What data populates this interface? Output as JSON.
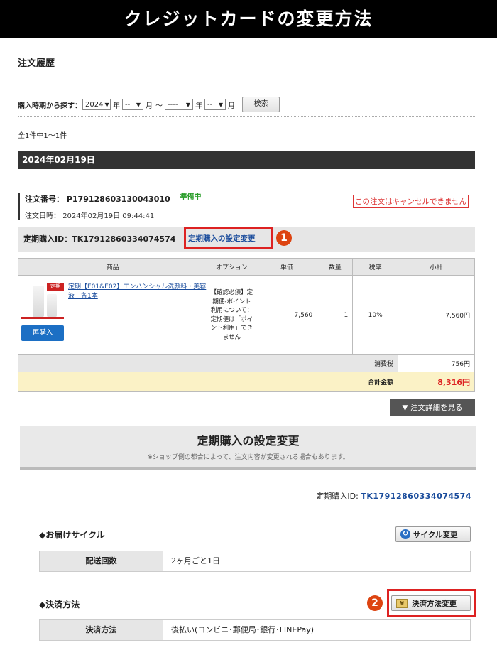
{
  "banner": "クレジットカードの変更方法",
  "section_title": "注文履歴",
  "search": {
    "label": "購入時期から探す：",
    "year_value": "2024",
    "year_unit": "年",
    "month_value": "--",
    "month_unit": "月",
    "tilde": "～",
    "year2_value": "----",
    "year2_unit": "年",
    "month2_value": "--",
    "month2_unit": "月",
    "button": "検索"
  },
  "result_count": "全1件中1～1件",
  "date_band": "2024年02月19日",
  "order": {
    "number_label": "注文番号：",
    "number": "P179128603130043010",
    "status": "準備中",
    "date_label": "注文日時：",
    "date": "2024年02月19日 09:44:41",
    "cancel_note": "この注文はキャンセルできません"
  },
  "subscription": {
    "id_label": "定期購入ID：",
    "id": "TK17912860334074574",
    "settings_link": "定期購入の設定変更"
  },
  "badges": {
    "one": "1",
    "two": "2"
  },
  "table": {
    "headers": [
      "商品",
      "オプション",
      "単価",
      "数量",
      "税率",
      "小計"
    ],
    "row": {
      "product_tag": "定期",
      "product_name": "定期【E01&E02】エンハンシャル洗顔料・美容液　各1本",
      "rebuy": "再購入",
      "option": "【確認必須】定期便-ポイント利用について：定期便は「ポイント利用」できません",
      "unit_price": "7,560",
      "qty": "1",
      "tax_rate": "10%",
      "subtotal": "7,560円"
    },
    "tax_label": "消費税",
    "tax_value": "756円",
    "total_label": "合計金額",
    "total_value": "8,316円"
  },
  "detail_button": "▼ 注文詳細を見る",
  "sub_section": {
    "title": "定期購入の設定変更",
    "note": "※ショップ側の都合によって、注文内容が変更される場合もあります。",
    "id_label": "定期購入ID:",
    "id": "TK17912860334074574"
  },
  "delivery": {
    "heading": "◆お届けサイクル",
    "button": "サイクル変更",
    "key": "配送回数",
    "value": "2ヶ月ごと1日"
  },
  "payment": {
    "heading": "◆決済方法",
    "button": "決済方法変更",
    "key": "決済方法",
    "value": "後払い(コンビニ･郵便局･銀行･LINEPay)"
  },
  "colors": {
    "accent_red": "#d22222",
    "link_blue": "#1a4c9c",
    "status_green": "#2a9d2a"
  }
}
